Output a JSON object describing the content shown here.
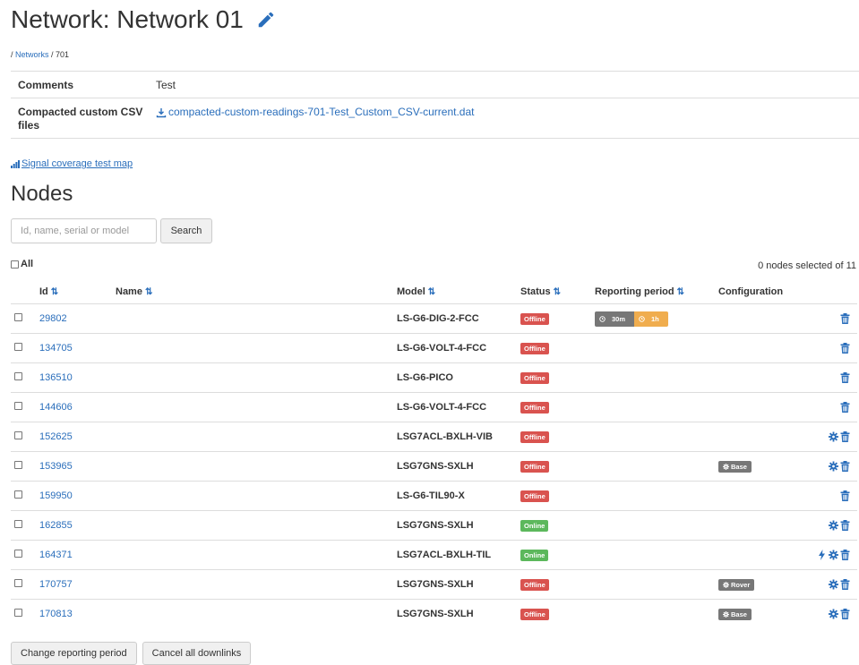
{
  "header": {
    "title": "Network: Network 01"
  },
  "breadcrumb": {
    "sep": "/ ",
    "link": "Networks",
    "current": " / 701"
  },
  "meta": {
    "comments_label": "Comments",
    "comments_value": "Test",
    "csv_label": "Compacted custom CSV files",
    "csv_link": "compacted-custom-readings-701-Test_Custom_CSV-current.dat"
  },
  "signal_map": "Signal coverage test map",
  "nodes": {
    "heading": "Nodes",
    "search_placeholder": "Id, name, serial or model",
    "search_button": "Search",
    "all_label": "All",
    "selected_count": "0 nodes selected of 11",
    "columns": {
      "id": "Id",
      "name": "Name",
      "model": "Model",
      "status": "Status",
      "reporting": "Reporting period",
      "config": "Configuration"
    },
    "rows": [
      {
        "id": "29802",
        "model": "LS-G6-DIG-2-FCC",
        "status": "Offline",
        "rp": [
          "30m",
          "1h"
        ],
        "config": "",
        "actions": [
          "trash"
        ]
      },
      {
        "id": "134705",
        "model": "LS-G6-VOLT-4-FCC",
        "status": "Offline",
        "rp": [],
        "config": "",
        "actions": [
          "trash"
        ]
      },
      {
        "id": "136510",
        "model": "LS-G6-PICO",
        "status": "Offline",
        "rp": [],
        "config": "",
        "actions": [
          "trash"
        ]
      },
      {
        "id": "144606",
        "model": "LS-G6-VOLT-4-FCC",
        "status": "Offline",
        "rp": [],
        "config": "",
        "actions": [
          "trash"
        ]
      },
      {
        "id": "152625",
        "model": "LSG7ACL-BXLH-VIB",
        "status": "Offline",
        "rp": [],
        "config": "",
        "actions": [
          "gear",
          "trash"
        ]
      },
      {
        "id": "153965",
        "model": "LSG7GNS-SXLH",
        "status": "Offline",
        "rp": [],
        "config": "Base",
        "actions": [
          "gear",
          "trash"
        ]
      },
      {
        "id": "159950",
        "model": "LS-G6-TIL90-X",
        "status": "Offline",
        "rp": [],
        "config": "",
        "actions": [
          "trash"
        ]
      },
      {
        "id": "162855",
        "model": "LSG7GNS-SXLH",
        "status": "Online",
        "rp": [],
        "config": "",
        "actions": [
          "gear",
          "trash"
        ]
      },
      {
        "id": "164371",
        "model": "LSG7ACL-BXLH-TIL",
        "status": "Online",
        "rp": [],
        "config": "",
        "actions": [
          "bolt",
          "gear",
          "trash"
        ]
      },
      {
        "id": "170757",
        "model": "LSG7GNS-SXLH",
        "status": "Offline",
        "rp": [],
        "config": "Rover",
        "actions": [
          "gear",
          "trash"
        ]
      },
      {
        "id": "170813",
        "model": "LSG7GNS-SXLH",
        "status": "Offline",
        "rp": [],
        "config": "Base",
        "actions": [
          "gear",
          "trash"
        ]
      }
    ]
  },
  "footer": {
    "change_period": "Change reporting period",
    "cancel_downlinks": "Cancel all downlinks"
  },
  "colors": {
    "link": "#2a6ebb",
    "offline": "#d9534f",
    "online": "#5cb85c",
    "period_orange": "#f0ad4e",
    "config_gray": "#777777"
  }
}
